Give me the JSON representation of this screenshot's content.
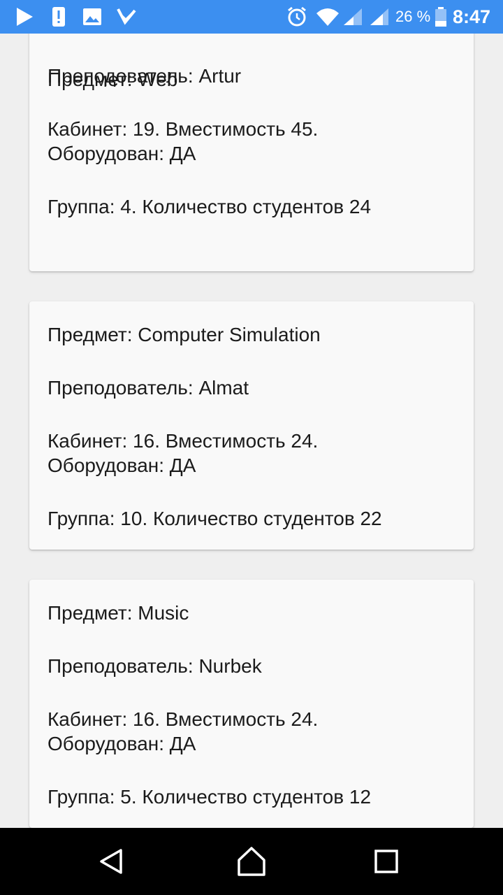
{
  "status_bar": {
    "battery_percent": "26 %",
    "time": "8:47",
    "background_color": "#3c8ff0",
    "left_icons": [
      "play-store-icon",
      "alert-icon",
      "image-icon",
      "task-check-icon"
    ],
    "right_icons": [
      "alarm-icon",
      "wifi-icon",
      "signal-icon",
      "signal-icon",
      "battery-icon"
    ]
  },
  "cards": [
    {
      "subject": "Предмет: Web",
      "teacher": "Преподователь: Artur",
      "room_line1": "Кабинет: 19. Вместимость 45.",
      "room_line2": "Оборудован: ДА",
      "group": "Группа: 4. Количество студентов 24"
    },
    {
      "subject": "Предмет: Computer Simulation",
      "teacher": "Преподователь: Almat",
      "room_line1": "Кабинет: 16. Вместимость 24.",
      "room_line2": "Оборудован: ДА",
      "group": "Группа: 10. Количество студентов 22"
    },
    {
      "subject": "Предмет: Music",
      "teacher": "Преподователь: Nurbek",
      "room_line1": "Кабинет: 16. Вместимость 24.",
      "room_line2": "Оборудован: ДА",
      "group": "Группа: 5. Количество студентов 12"
    }
  ],
  "nav_bar": {
    "buttons": [
      "back-icon",
      "home-icon",
      "recents-icon"
    ]
  }
}
